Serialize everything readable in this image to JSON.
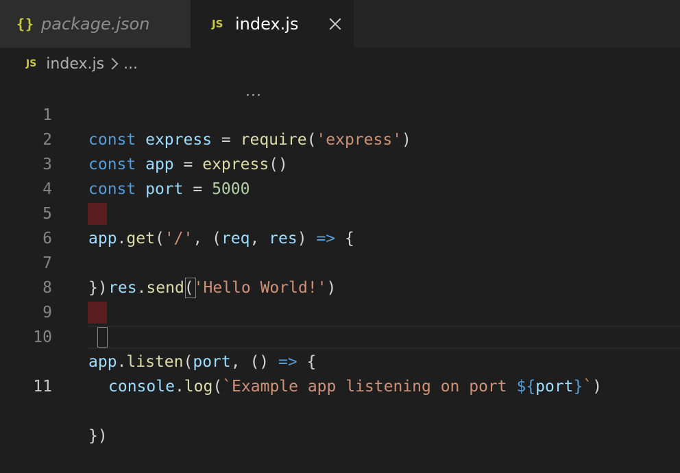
{
  "tabs": [
    {
      "icon": "{}",
      "label": "package.json",
      "active": false
    },
    {
      "icon": "JS",
      "label": "index.js",
      "active": true
    }
  ],
  "breadcrumb": {
    "icon": "JS",
    "file": "index.js",
    "more": "..."
  },
  "editor": {
    "current_line": 11,
    "lines": [
      {
        "num": "1"
      },
      {
        "num": "2"
      },
      {
        "num": "3"
      },
      {
        "num": "4"
      },
      {
        "num": "5"
      },
      {
        "num": "6"
      },
      {
        "num": "7"
      },
      {
        "num": "8"
      },
      {
        "num": "9"
      },
      {
        "num": "10"
      },
      {
        "num": "11"
      }
    ],
    "tokens": {
      "l1": [
        "const",
        "express",
        "=",
        "require",
        "(",
        "'express'",
        ")"
      ],
      "l2": [
        "const",
        "app",
        "=",
        "express",
        "()"
      ],
      "l3": [
        "const",
        "port",
        "=",
        "5000"
      ],
      "l5": [
        "app",
        ".",
        "get",
        "(",
        "'/'",
        ", (",
        "req",
        ",",
        "res",
        ")",
        "=>",
        "{"
      ],
      "l6": [
        "res",
        ".",
        "send",
        "(",
        "'Hello World!'",
        ")"
      ],
      "l7": [
        "})"
      ],
      "l9": [
        "app",
        ".",
        "listen",
        "(",
        "port",
        ", () ",
        "=>",
        " {"
      ],
      "l10": [
        "console",
        ".",
        "log",
        "(",
        "`Example app listening on port ",
        "${",
        "port",
        "}",
        "`",
        ")"
      ],
      "l11": [
        "})"
      ]
    }
  },
  "colors": {
    "keyword": "#569cd6",
    "variable": "#9cdcfe",
    "constant": "#4fc1ff",
    "function": "#dcdcaa",
    "string": "#ce9178",
    "number": "#b5cea8",
    "js_icon": "#cbcb41",
    "indent_error": "#5a1d1d"
  }
}
